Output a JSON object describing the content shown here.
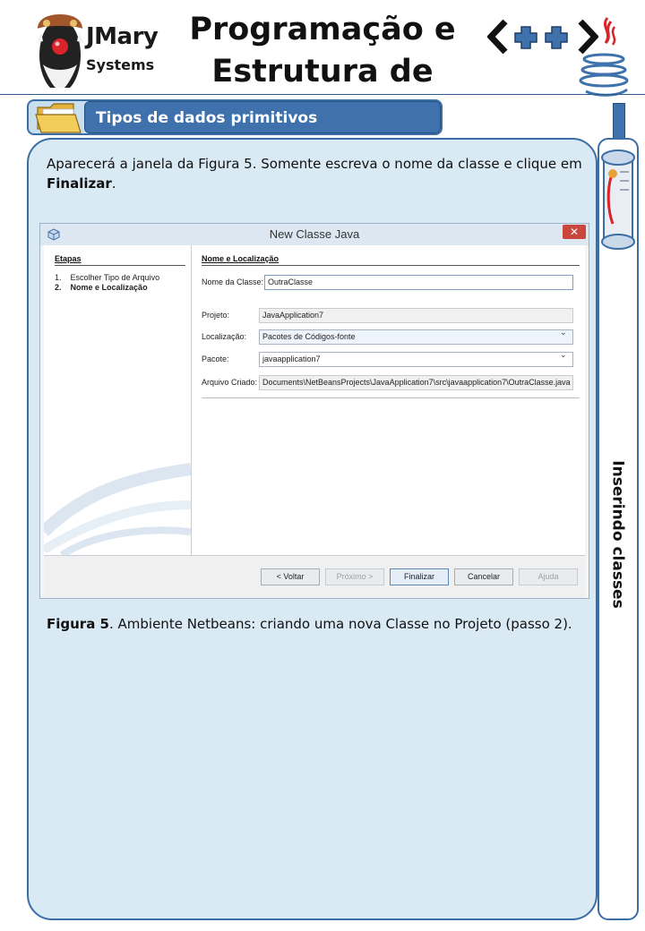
{
  "header": {
    "logo_line1": "JMary",
    "logo_line2": "Systems",
    "title_line1": "Programação e",
    "title_line2": "Estrutura de Dados",
    "cpp_logo_icon": "cpp-logo-icon",
    "java_logo_icon": "java-cup-icon"
  },
  "section": {
    "title": "Tipos de dados primitivos (representação)",
    "icon": "folder-icon"
  },
  "sidebar": {
    "label": "Inserindo classes",
    "icon": "scroll-icon"
  },
  "content": {
    "intro_text": "Aparecerá a janela da Figura 5. Somente escreva o nome da classe e clique em ",
    "intro_bold": "Finalizar",
    "intro_end": ".",
    "caption_bold": "Figura 5",
    "caption_text": ". Ambiente Netbeans: criando uma nova Classe no Projeto (passo 2)."
  },
  "dialog": {
    "title": "New Classe Java",
    "close_glyph": "✕",
    "steps": {
      "heading": "Etapas",
      "items": [
        {
          "num": "1.",
          "label": "Escolher Tipo de Arquivo"
        },
        {
          "num": "2.",
          "label": "Nome e Localização"
        }
      ]
    },
    "form": {
      "heading": "Nome e Localização",
      "class_name_label": "Nome da Classe:",
      "class_name_value": "OutraClasse",
      "project_label": "Projeto:",
      "project_value": "JavaApplication7",
      "location_label": "Localização:",
      "location_value": "Pacotes de Códigos-fonte",
      "package_label": "Pacote:",
      "package_value": "javaapplication7",
      "created_file_label": "Arquivo Criado:",
      "created_file_value": "Documents\\NetBeansProjects\\JavaApplication7\\src\\javaapplication7\\OutraClasse.java",
      "dropdown_glyph": "⌄"
    },
    "buttons": {
      "back": "< Voltar",
      "next": "Próximo >",
      "finish": "Finalizar",
      "cancel": "Cancelar",
      "help": "Ajuda"
    }
  },
  "colors": {
    "panel_bg": "#daeaf5",
    "accent_blue": "#3f72ad",
    "border_blue": "#3b6ea5"
  }
}
